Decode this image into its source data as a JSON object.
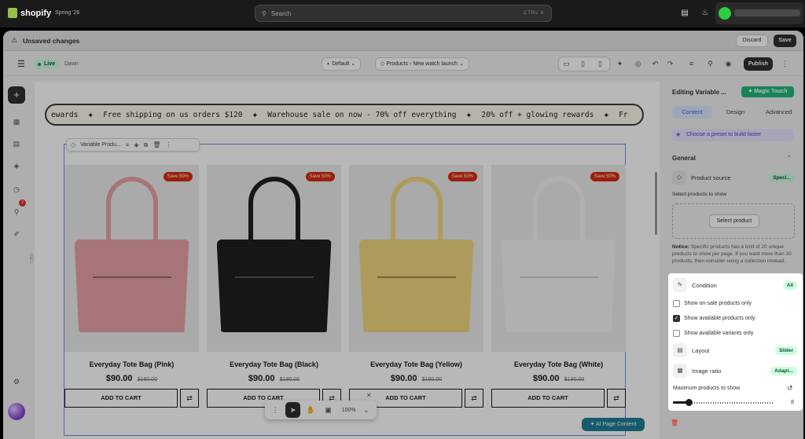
{
  "topbar": {
    "brand": "shopify",
    "store_name": "Spring '26",
    "search_placeholder": "Search",
    "search_shortcut": "CTRL  K"
  },
  "unsaved_bar": {
    "message": "Unsaved changes",
    "discard_label": "Discard",
    "save_label": "Save"
  },
  "editor_toolbar": {
    "status": "Live",
    "theme": "Dawn",
    "template_select": "Default",
    "page_select_type": "Products",
    "page_select_value": "New watch launch",
    "publish_label": "Publish"
  },
  "left_rail": {
    "notification_count": "3"
  },
  "canvas": {
    "marquee": {
      "lead": "ewards",
      "items": [
        "Free shipping on us orders $120",
        "Warehouse sale on now - 70% off everything",
        "20% off + glowing rewards"
      ],
      "trail": "Fr"
    },
    "section_label": "Variable Produ...",
    "products": [
      {
        "title": "Everyday Tote Bag (Pink)",
        "price": "$90.00",
        "compare": "$180.00",
        "badge": "Save 50%",
        "cart": "ADD TO CART",
        "color": "#e8a3a5"
      },
      {
        "title": "Everyday Tote Bag (Black)",
        "price": "$90.00",
        "compare": "$180.00",
        "badge": "Save 50%",
        "cart": "ADD TO CART",
        "color": "#1f1f1f"
      },
      {
        "title": "Everyday Tote Bag (Yellow)",
        "price": "$90.00",
        "compare": "$180.00",
        "badge": "Save 50%",
        "cart": "ADD TO CART",
        "color": "#efd77d"
      },
      {
        "title": "Everyday Tote Bag (White)",
        "price": "$90.00",
        "compare": "$180.00",
        "badge": "Save 50%",
        "cart": "ADD TO CART",
        "color": "#f4f4f2"
      }
    ],
    "zoom_level": "100%",
    "ai_button": "AI Page Content"
  },
  "panel": {
    "header": "Editing Variable ...",
    "magic_label": "Magic Touch",
    "tabs": [
      "Content",
      "Design",
      "Advanced"
    ],
    "preset_label": "Choose a preset to build faster",
    "general_label": "General",
    "product_source_label": "Product source",
    "product_source_value": "Speci...",
    "select_products_label": "Select products to show",
    "select_product_button": "Select product",
    "notice_bold": "Notice:",
    "notice_text": "Specific products has a limit of 20 unique products to show per page. If you want more than 20 products, then consider using a collection instead.",
    "condition_label": "Condition",
    "condition_value": "All",
    "checkboxes": [
      {
        "label": "Show on-sale products only",
        "checked": false
      },
      {
        "label": "Show available products only",
        "checked": true
      },
      {
        "label": "Show available variants only",
        "checked": false
      }
    ],
    "layout_label": "Layout",
    "layout_value": "Slider",
    "image_ratio_label": "Image ratio",
    "image_ratio_value": "Adapt...",
    "max_products_label": "Maximum products to show",
    "max_products_value": "8"
  }
}
